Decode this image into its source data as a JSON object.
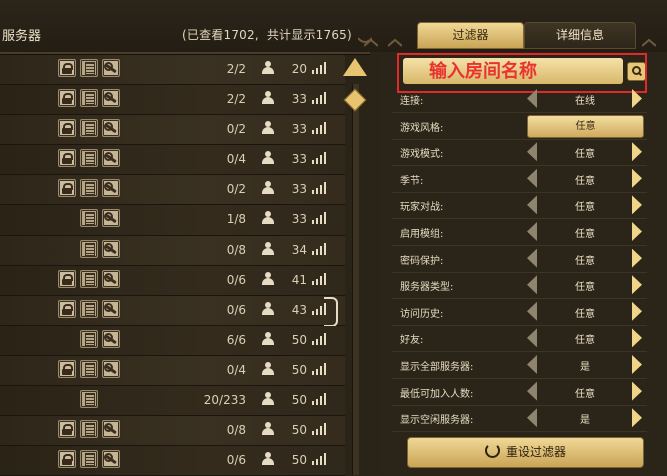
{
  "header": {
    "title": "服务器",
    "viewed_prefix": "(已查看",
    "viewed_count": "1702",
    "comma": ",",
    "total_prefix": "共计显示",
    "total_count": "1765",
    "suffix": ")"
  },
  "servers": [
    {
      "lock": true,
      "doc": true,
      "wrench": true,
      "players": "2/2",
      "days": "20"
    },
    {
      "lock": true,
      "doc": true,
      "wrench": true,
      "players": "2/2",
      "days": "33"
    },
    {
      "lock": true,
      "doc": true,
      "wrench": true,
      "players": "0/2",
      "days": "33"
    },
    {
      "lock": true,
      "doc": true,
      "wrench": true,
      "players": "0/4",
      "days": "33"
    },
    {
      "lock": true,
      "doc": true,
      "wrench": true,
      "players": "0/2",
      "days": "33"
    },
    {
      "lock": false,
      "doc": true,
      "wrench": true,
      "players": "1/8",
      "days": "33"
    },
    {
      "lock": false,
      "doc": true,
      "wrench": true,
      "players": "0/8",
      "days": "34"
    },
    {
      "lock": true,
      "doc": true,
      "wrench": true,
      "players": "0/6",
      "days": "41"
    },
    {
      "lock": true,
      "doc": true,
      "wrench": true,
      "players": "0/6",
      "days": "43",
      "selected": true
    },
    {
      "lock": false,
      "doc": true,
      "wrench": true,
      "players": "6/6",
      "days": "50"
    },
    {
      "lock": true,
      "doc": true,
      "wrench": true,
      "players": "0/4",
      "days": "50"
    },
    {
      "lock": false,
      "doc": true,
      "wrench": false,
      "players": "20/233",
      "days": "50"
    },
    {
      "lock": true,
      "doc": true,
      "wrench": true,
      "players": "0/8",
      "days": "50"
    },
    {
      "lock": true,
      "doc": true,
      "wrench": true,
      "players": "0/6",
      "days": "50"
    }
  ],
  "tabs": {
    "filter": "过滤器",
    "detail": "详细信息"
  },
  "name_input": {
    "value": "",
    "placeholder": "输入房间名称"
  },
  "filters": [
    {
      "label": "连接:",
      "value": "在线",
      "type": "arrows"
    },
    {
      "label": "游戏风格:",
      "value": "任意",
      "type": "button"
    },
    {
      "label": "游戏模式:",
      "value": "任意",
      "type": "arrows"
    },
    {
      "label": "季节:",
      "value": "任意",
      "type": "arrows"
    },
    {
      "label": "玩家对战:",
      "value": "任意",
      "type": "arrows"
    },
    {
      "label": "启用模组:",
      "value": "任意",
      "type": "arrows"
    },
    {
      "label": "密码保护:",
      "value": "任意",
      "type": "arrows"
    },
    {
      "label": "服务器类型:",
      "value": "任意",
      "type": "arrows"
    },
    {
      "label": "访问历史:",
      "value": "任意",
      "type": "arrows"
    },
    {
      "label": "好友:",
      "value": "任意",
      "type": "arrows"
    },
    {
      "label": "显示全部服务器:",
      "value": "是",
      "type": "arrows"
    },
    {
      "label": "最低可加入人数:",
      "value": "任意",
      "type": "arrows"
    },
    {
      "label": "显示空闲服务器:",
      "value": "是",
      "type": "arrows"
    }
  ],
  "reset_label": "重设过滤器",
  "colors": {
    "accent_gold": "#e8c470",
    "highlight_red": "#e02a2a",
    "panel_bg": "#2b2418"
  },
  "icons": [
    "lock-icon",
    "document-icon",
    "wrench-icon",
    "person-icon",
    "signal-icon",
    "search-icon",
    "reset-icon"
  ]
}
